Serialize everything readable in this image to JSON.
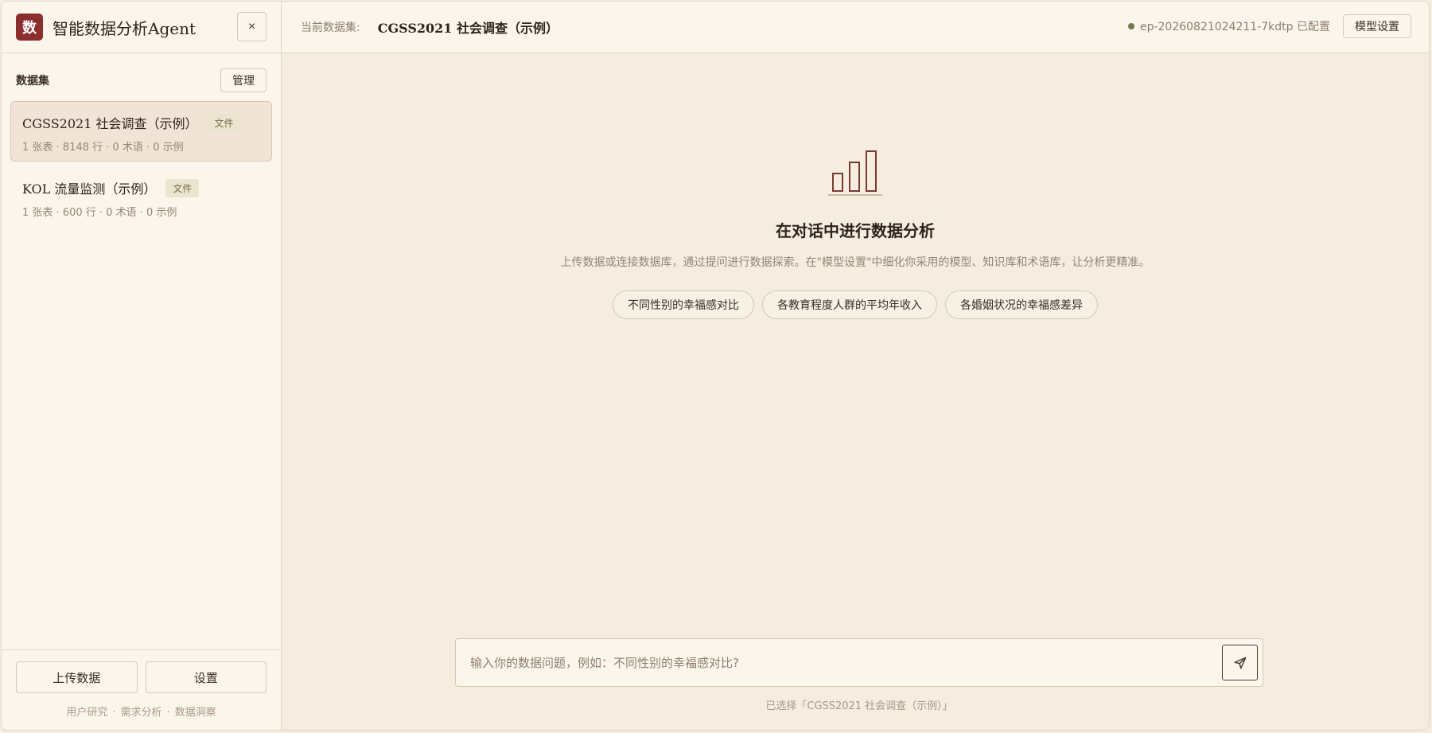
{
  "sidebar": {
    "logo_char": "数",
    "app_title": "智能数据分析Agent",
    "close_label": "×",
    "section_title": "数据集",
    "manage_label": "管理",
    "datasets": [
      {
        "name": "CGSS2021 社会调查（示例）",
        "badge": "文件",
        "meta": "1 张表 · 8148 行 · 0 术语 · 0 示例",
        "active": true
      },
      {
        "name": "KOL 流量监测（示例）",
        "badge": "文件",
        "meta": "1 张表 · 600 行 · 0 术语 · 0 示例",
        "active": false
      }
    ],
    "upload_label": "上传数据",
    "settings_label": "设置",
    "tags": [
      "用户研究",
      "需求分析",
      "数据洞察"
    ],
    "tag_separator": "·"
  },
  "topbar": {
    "current_label": "当前数据集:",
    "current_dataset": "CGSS2021 社会调查（示例）",
    "model_status": "ep-20260821024211-7kdtp 已配置",
    "model_settings_label": "模型设置"
  },
  "empty_state": {
    "icon": "bar-chart-icon",
    "title": "在对话中进行数据分析",
    "description": "上传数据或连接数据库，通过提问进行数据探索。在\"模型设置\"中细化你采用的模型、知识库和术语库，让分析更精准。",
    "suggestions": [
      "不同性别的幸福感对比",
      "各教育程度人群的平均年收入",
      "各婚姻状况的幸福感差异"
    ]
  },
  "composer": {
    "placeholder": "输入你的数据问题，例如：不同性别的幸福感对比?",
    "value": "",
    "hint": "已选择「CGSS2021 社会调查（示例）」"
  },
  "colors": {
    "accent": "#8b2e2e",
    "background": "#f4ede0",
    "panel": "#fbf6ec",
    "status_dot": "#6e7a52"
  }
}
